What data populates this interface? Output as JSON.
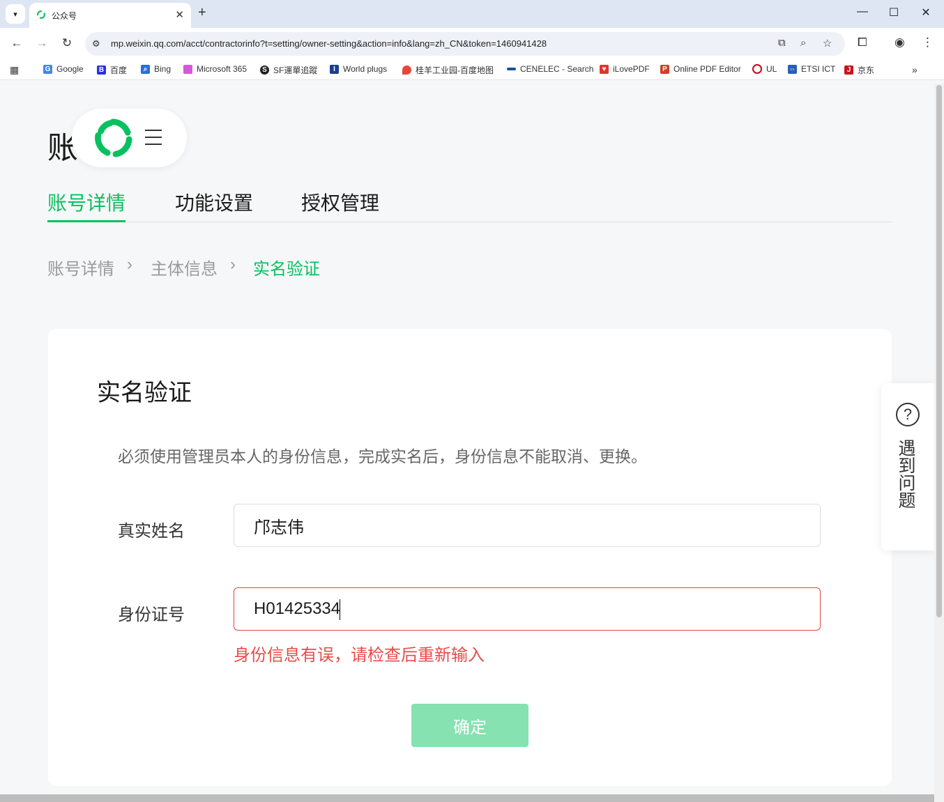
{
  "browser": {
    "tab_title": "公众号",
    "url": "mp.weixin.qq.com/acct/contractorinfo?t=setting/owner-setting&action=info&lang=zh_CN&token=1460941428",
    "bookmarks": [
      {
        "label": "Google",
        "icon": "google-icon",
        "color": "#4285f4"
      },
      {
        "label": "百度",
        "icon": "baidu-icon",
        "color": "#2932e1"
      },
      {
        "label": "Bing",
        "icon": "bing-search-icon",
        "color": "#2b6fd6"
      },
      {
        "label": "Microsoft 365",
        "icon": "microsoft365-icon",
        "color": "#d35ad6"
      },
      {
        "label": "SF運單追蹤",
        "icon": "sf-icon",
        "color": "#222222"
      },
      {
        "label": "World plugs",
        "icon": "iec-icon",
        "color": "#1b3f8f"
      },
      {
        "label": "桂羊工业园-百度地图",
        "icon": "map-pin-icon",
        "color": "#e5483b"
      },
      {
        "label": "CENELEC - Search",
        "icon": "cenelec-icon",
        "color": "#1d4fa3"
      },
      {
        "label": "iLovePDF",
        "icon": "ilovepdf-icon",
        "color": "#e5322d"
      },
      {
        "label": "Online PDF Editor",
        "icon": "pdf-editor-icon",
        "color": "#d83b2b"
      },
      {
        "label": "UL",
        "icon": "ul-icon",
        "color": "#d0021b"
      },
      {
        "label": "ETSI ICT",
        "icon": "etsi-icon",
        "color": "#2a5fb3"
      },
      {
        "label": "京东",
        "icon": "jd-icon",
        "color": "#c9151e"
      }
    ]
  },
  "page": {
    "title_partial": "账",
    "tabs": [
      "账号详情",
      "功能设置",
      "授权管理"
    ],
    "breadcrumb": [
      "账号详情",
      "主体信息",
      "实名验证"
    ]
  },
  "card": {
    "title": "实名验证",
    "notice": "必须使用管理员本人的身份信息，完成实名后，身份信息不能取消、更换。",
    "name_label": "真实姓名",
    "name_value": "邝志伟",
    "id_label": "身份证号",
    "id_value": "H01425334",
    "error": "身份信息有误，请检查后重新输入",
    "confirm_label": "确定"
  },
  "help": {
    "label": "遇到问题"
  },
  "colors": {
    "accent": "#07c160",
    "error": "#ea4b4b",
    "button_disabled": "#86e2b1"
  }
}
